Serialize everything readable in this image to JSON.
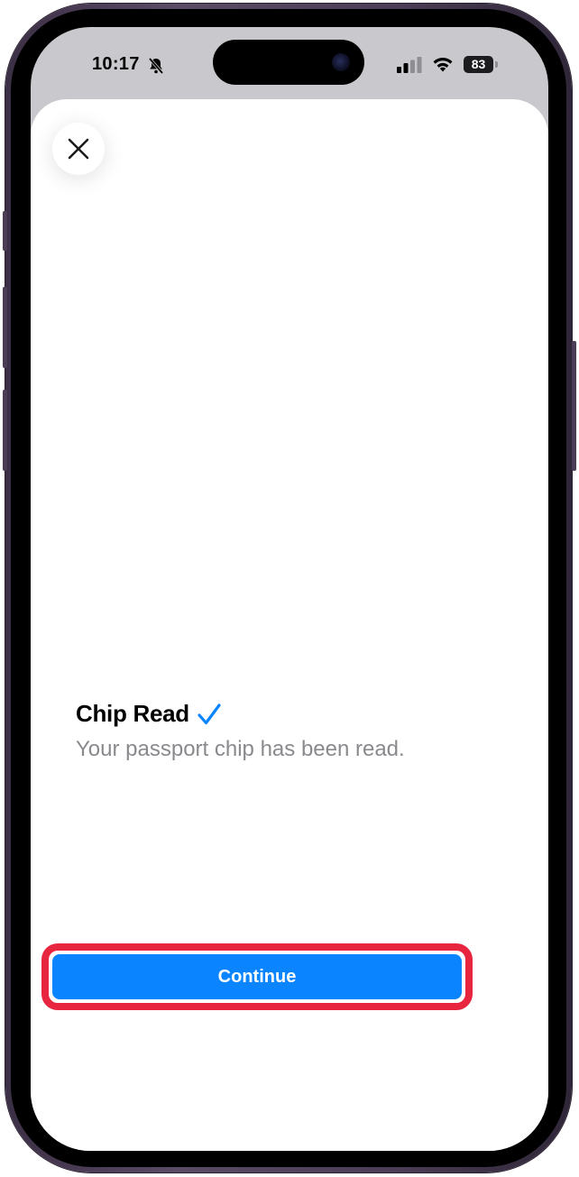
{
  "status_bar": {
    "time": "10:17",
    "battery": "83",
    "icons": [
      "bell-slash-icon",
      "cellular-signal-icon",
      "wifi-icon",
      "battery-icon"
    ]
  },
  "sheet": {
    "close_icon": "close-icon",
    "title": "Chip Read",
    "title_icon": "checkmark-icon",
    "subtitle": "Your passport chip has been read.",
    "continue_label": "Continue"
  },
  "colors": {
    "accent": "#0a84ff",
    "highlight": "#e8253f",
    "subtitle": "#8a8a8e"
  }
}
